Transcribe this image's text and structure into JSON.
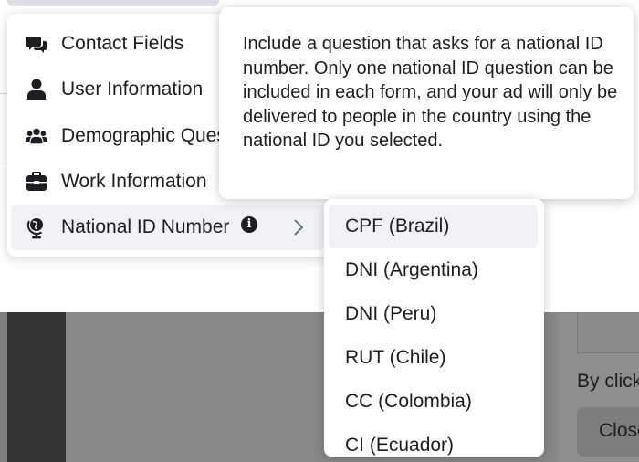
{
  "background": {
    "right_text": "By click",
    "right_button": "Close"
  },
  "menu": {
    "items": [
      {
        "label": "Contact Fields",
        "icon": "chat-bubbles-icon"
      },
      {
        "label": "User Information",
        "icon": "person-icon"
      },
      {
        "label": "Demographic Questions",
        "icon": "people-group-icon"
      },
      {
        "label": "Work Information",
        "icon": "briefcase-icon"
      },
      {
        "label": "National ID Number",
        "icon": "globe-stand-icon",
        "active": true
      }
    ],
    "info_glyph": "i"
  },
  "tooltip": {
    "text": "Include a question that asks for a national ID number. Only one national ID question can be included in each form, and your ad will only be delivered to people in the country using the national ID you selected."
  },
  "submenu": {
    "items": [
      {
        "label": "CPF (Brazil)",
        "active": true
      },
      {
        "label": "DNI (Argentina)"
      },
      {
        "label": "DNI (Peru)"
      },
      {
        "label": "RUT (Chile)"
      },
      {
        "label": "CC (Colombia)"
      },
      {
        "label": "CI (Ecuador)"
      }
    ]
  },
  "colors": {
    "hover": "#f0f2f5",
    "text": "#1c1e21",
    "overlay": "#888888"
  }
}
